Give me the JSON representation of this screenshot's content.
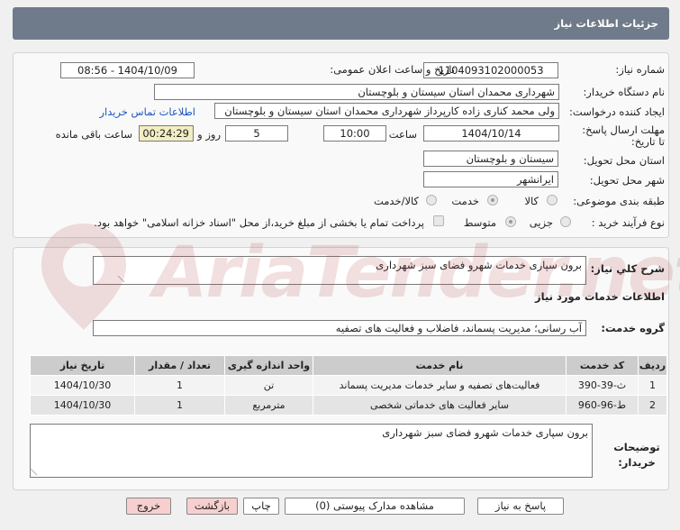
{
  "header": {
    "title": "جزئیات اطلاعات نیاز"
  },
  "form": {
    "need_number_label": "شماره نیاز:",
    "need_number": "1104093102000053",
    "announce_label": "تاریخ و ساعت اعلان عمومی:",
    "announce_value": "1404/10/09 - 08:56",
    "buyer_org_label": "نام دستگاه خریدار:",
    "buyer_org": "شهرداری محمدان استان سیستان و بلوچستان",
    "creator_label": "ایجاد کننده درخواست:",
    "creator": "ولی محمد کناری زاده کارپرداز شهرداری محمدان استان سیستان و بلوچستان",
    "contact_link": "اطلاعات تماس خریدار",
    "deadline_label": "مهلت ارسال پاسخ: تا تاریخ:",
    "deadline_date": "1404/10/14",
    "time_label": "ساعت",
    "deadline_time": "10:00",
    "days_value": "5",
    "days_label": "روز و",
    "remaining_time": "00:24:29",
    "remaining_label": "ساعت باقی مانده",
    "province_label": "استان محل تحویل:",
    "province": "سیستان و بلوچستان",
    "city_label": "شهر محل تحویل:",
    "city": "ایرانشهر",
    "category_label": "طبقه بندی موضوعی:",
    "category_options": [
      "کالا",
      "خدمت",
      "کالا/خدمت"
    ],
    "process_label": "نوع فرآیند خرید :",
    "process_options": [
      "جزیی",
      "متوسط"
    ],
    "payment_note": "پرداخت تمام یا بخشی از مبلغ خرید،از محل \"اسناد خزانه اسلامی\" خواهد بود."
  },
  "summary": {
    "label": "شرح كلي نياز:",
    "value": "برون سپاری خدمات شهرو فضای سبز شهرداری",
    "services_heading": "اطلاعات خدمات مورد نیاز",
    "group_label": "گروه خدمت:",
    "group_value": "آب رسانی؛ مدیریت پسماند، فاضلاب و فعالیت های تصفیه"
  },
  "table": {
    "headers": [
      "ردیف",
      "کد خدمت",
      "نام خدمت",
      "واحد اندازه گیری",
      "تعداد / مقدار",
      "تاریخ نیاز"
    ],
    "rows": [
      [
        "1",
        "ث-39-390",
        "فعالیت‌های تصفیه و سایر خدمات مدیریت پسماند",
        "تن",
        "1",
        "1404/10/30"
      ],
      [
        "2",
        "ط-96-960",
        "سایر فعالیت های خدماتی شخصی",
        "مترمربع",
        "1",
        "1404/10/30"
      ]
    ]
  },
  "buyer_notes": {
    "label": "توضیحات خریدار:",
    "value": "برون سپاری خدمات شهرو فضای سبز شهرداری"
  },
  "buttons": {
    "reply": "پاسخ به نیاز",
    "attachments": "مشاهده مدارک پیوستی (0)",
    "print": "چاپ",
    "back": "بازگشت",
    "exit": "خروج"
  },
  "watermark": {
    "text": "AriaTender.net"
  }
}
